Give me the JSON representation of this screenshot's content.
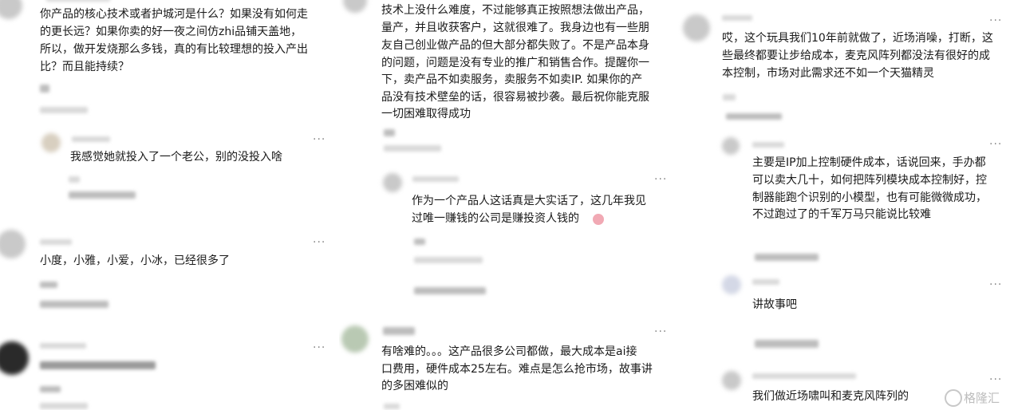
{
  "col1": {
    "main_comment": [
      "你产品的核心技术或者护城河是什么？如果没有如何走",
      "的更长远？如果你卖的好一夜之间仿zhi品铺天盖地，",
      "所以，做开发烧那么多钱，真的有比较理想的投入产出",
      "比？而且能持续？"
    ],
    "reply_1": "我感觉她就投入了一个老公，别的没投入啥",
    "comment_2": "小度，小雅，小爱，小冰，已经很多了",
    "more": "···"
  },
  "col2": {
    "main_comment": [
      "技术上没什么难度，不过能够真正按照想法做出产品，",
      "量产，并且收获客户，这就很难了。我身边也有一些朋",
      "友自己创业做产品的但大部分都失败了。不是产品本身",
      "的问题，问题是没有专业的推广和销售合作。提醒你一",
      "下，卖产品不如卖服务，卖服务不如卖IP. 如果你的产",
      "品没有技术壁垒的话，很容易被抄袭。最后祝你能克服",
      "一切困难取得成功"
    ],
    "reply_1": [
      "作为一个产品人这话真是大实话了，这几年我见",
      "过唯一赚钱的公司是赚投资人钱的"
    ],
    "comment_2": [
      "有啥难的。。。这产品很多公司都做，最大成本是ai接",
      "口费用，硬件成本25左右。难点是怎么抢市场，故事讲",
      "的多困难似的"
    ],
    "more": "···"
  },
  "col3": {
    "main_comment": [
      "哎，这个玩具我们10年前就做了，近场消噪，打断，这",
      "些最终都要让步给成本，麦克风阵列都没法有很好的成",
      "本控制，市场对此需求还不如一个天猫精灵"
    ],
    "reply_1": [
      "主要是IP加上控制硬件成本，话说回来，手办都",
      "可以卖大几十，如何把阵列模块成本控制好，控",
      "制器能跑个识别的小模型，也有可能微微成功，",
      "不过跑过了的千军万马只能说比较难"
    ],
    "reply_2": "讲故事吧",
    "reply_3": "我们做近场啸叫和麦克风阵列的",
    "more": "···"
  },
  "watermark": {
    "text": "格隆汇",
    "icon": "gelonghui-logo-icon"
  }
}
